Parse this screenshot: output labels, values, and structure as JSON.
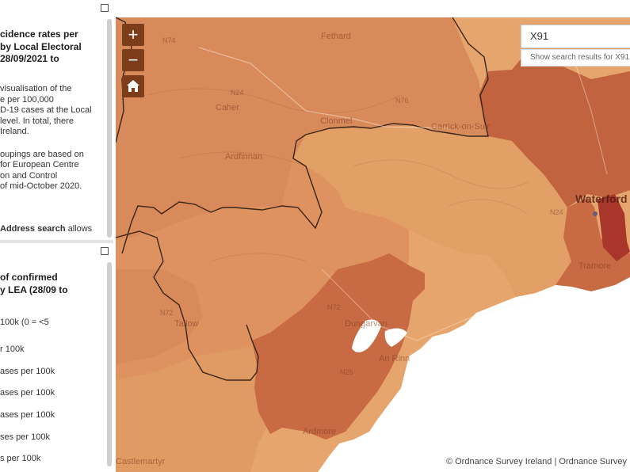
{
  "panels": {
    "top": {
      "title_lines": [
        "cidence rates per",
        "by Local Electoral",
        "28/09/2021 to"
      ],
      "body1_lines": [
        "visualisation of the",
        "e per 100,000",
        "D-19 cases at the Local",
        "level. In total, there",
        "Ireland."
      ],
      "body2_lines": [
        "oupings are based on",
        "for European Centre",
        "on and Control",
        "of mid-October 2020."
      ],
      "search_help": {
        "bold": "Address search",
        "rest": " allows"
      }
    },
    "bottom": {
      "title_lines": [
        "of confirmed",
        "y LEA (28/09 to"
      ],
      "legend": [
        "100k (0 = <5",
        "r 100k",
        "ases per 100k",
        "ases per 100k",
        "ases per 100k",
        "ses per 100k",
        "s per 100k"
      ]
    }
  },
  "map": {
    "place_labels": [
      "Fethard",
      "Caher",
      "Clonmel",
      "Carrick-on-Suir",
      "Ardfinnan",
      "Dungarvan",
      "An Rinn",
      "Tallow",
      "Ardmore",
      "Tramore",
      "Castlemartyr"
    ],
    "city_label": "Waterford",
    "road_labels": [
      "N74",
      "N24",
      "N76",
      "N24",
      "N72",
      "N72",
      "N25"
    ],
    "choropleth_colors": {
      "light": "#e6a56d",
      "medium": "#d8895a",
      "dark": "#c0633e",
      "darkest": "#a8362b",
      "sea": "#ffffff"
    },
    "zoom_in": "+",
    "zoom_out": "−",
    "home_icon": "home-icon"
  },
  "search": {
    "value": "X91",
    "hint": "Show search results for X91"
  },
  "attribution": "© Ordnance Survey Ireland | Ordnance Survey"
}
